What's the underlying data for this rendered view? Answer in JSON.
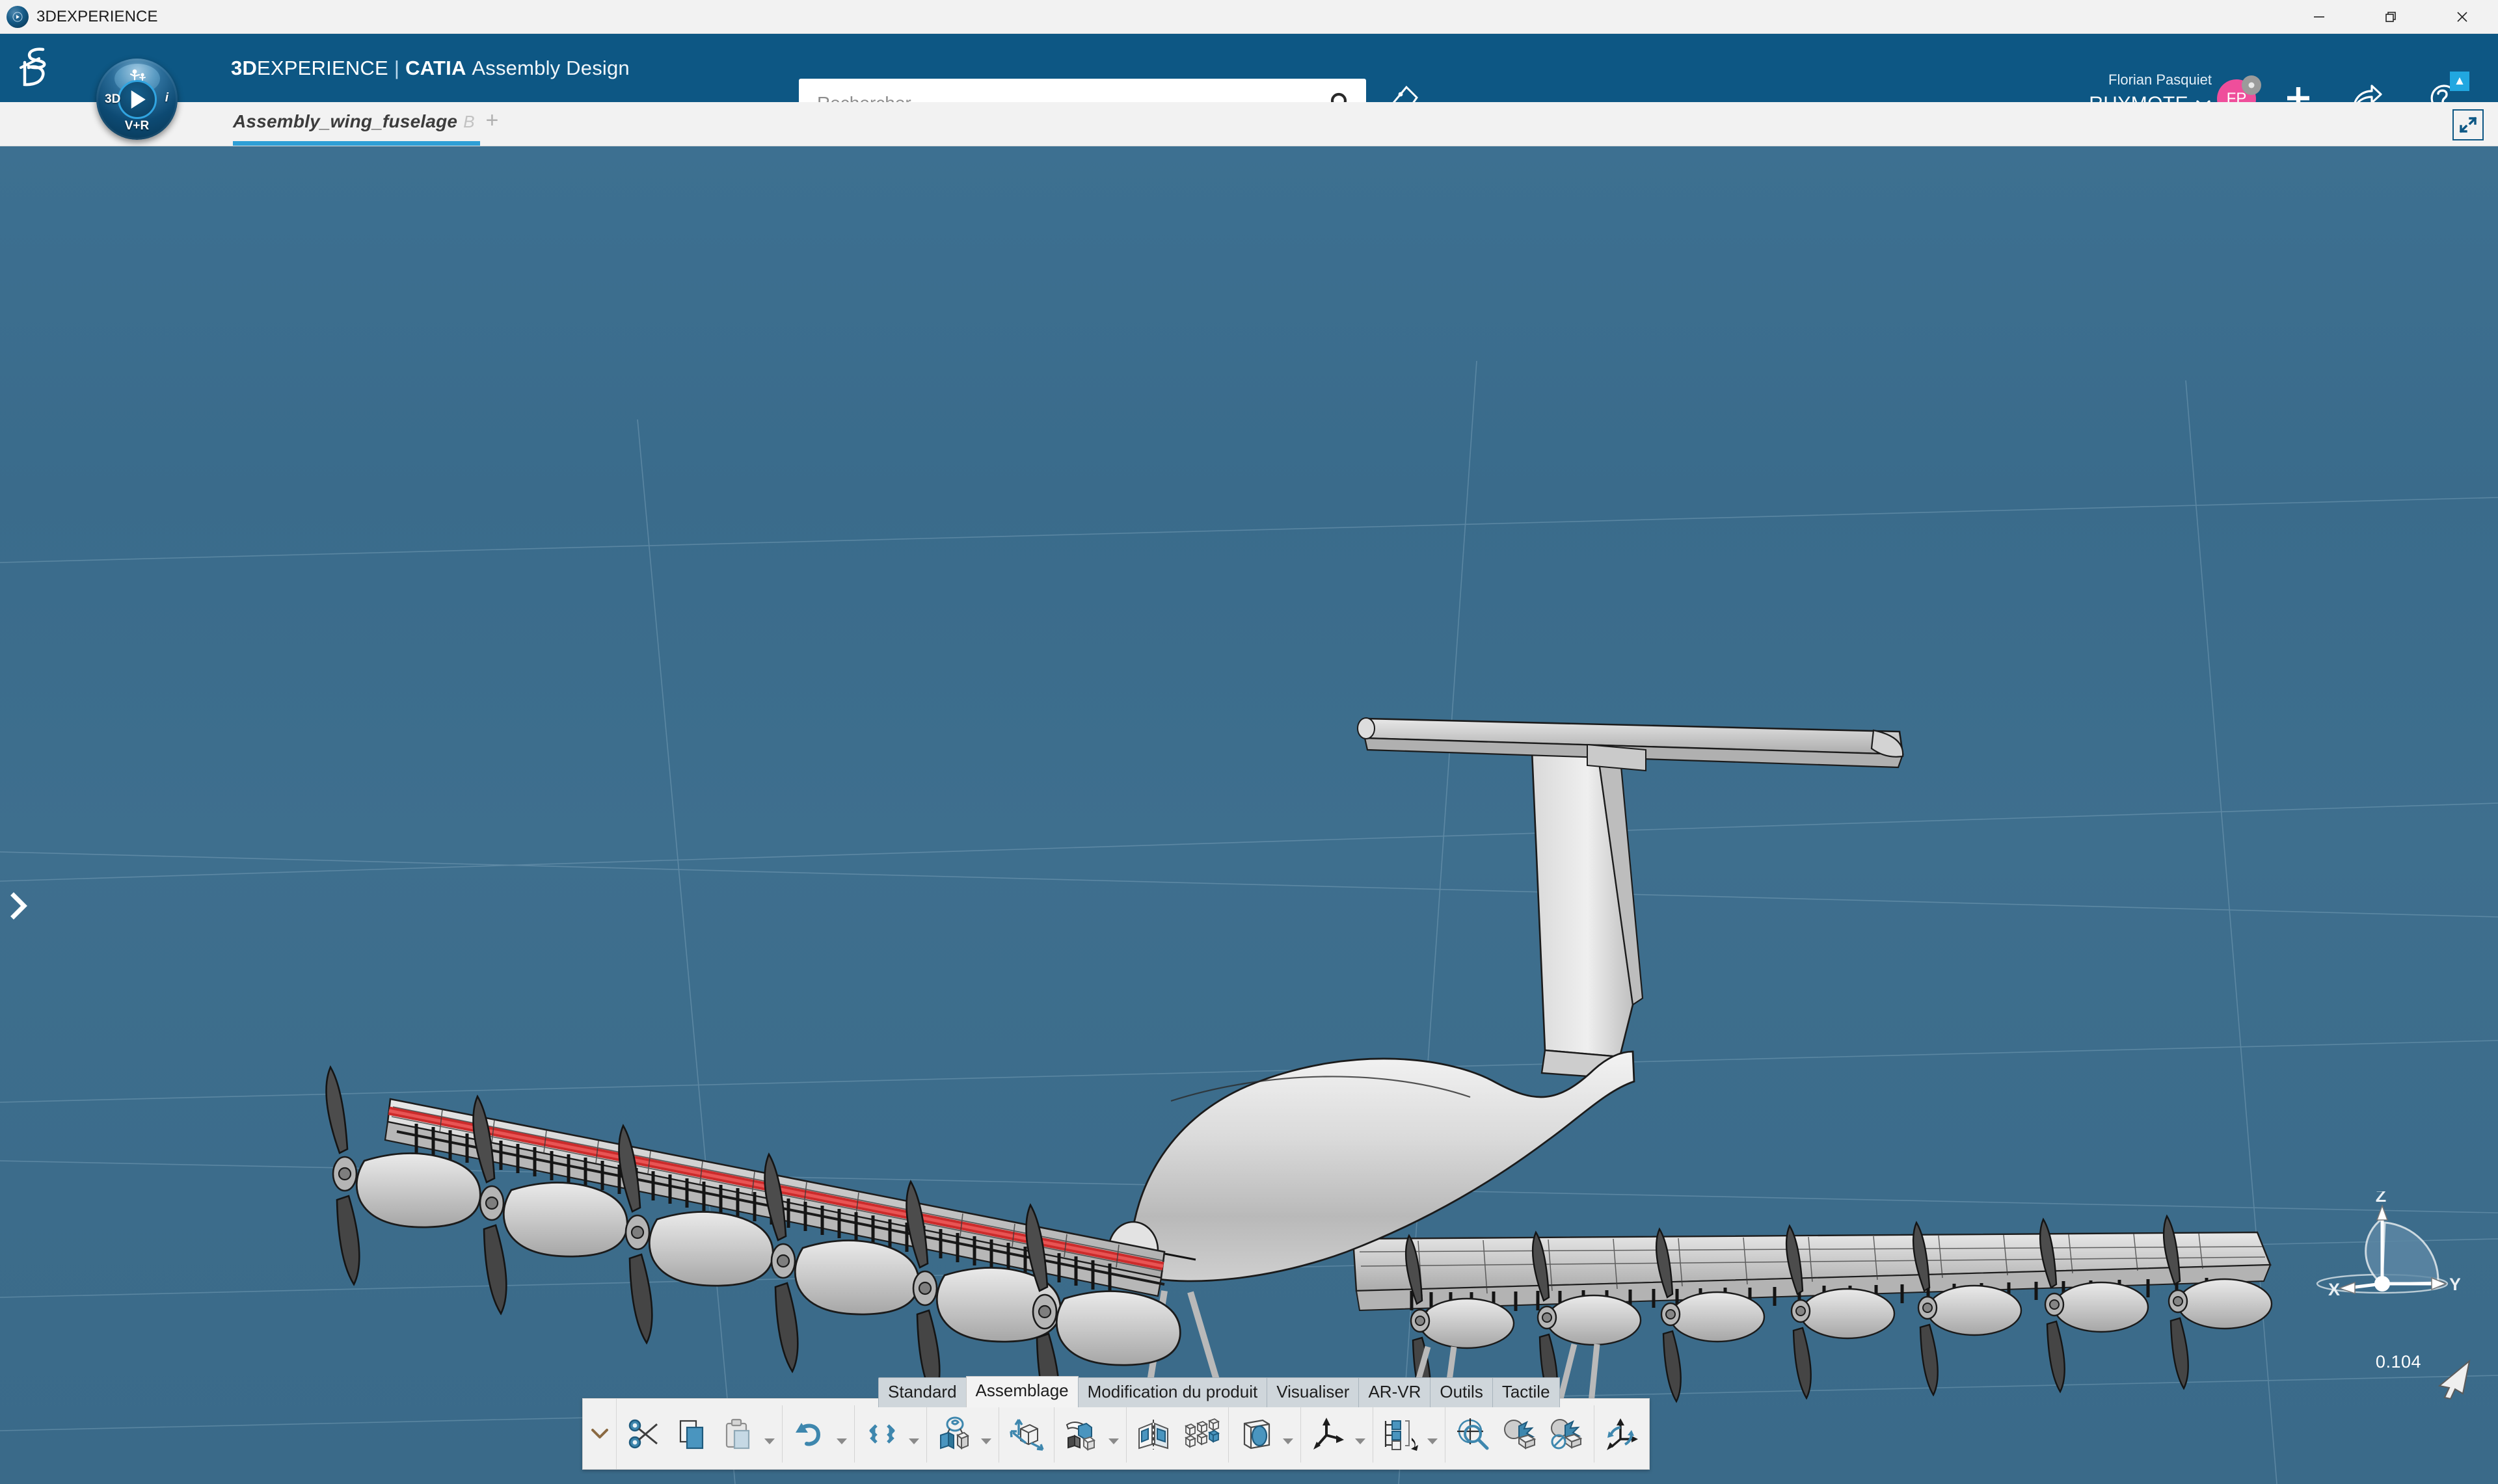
{
  "window": {
    "title": "3DEXPERIENCE",
    "logo_icon": "3dexperience-compass-icon",
    "controls": [
      {
        "name": "minimize",
        "icon": "minimize-icon"
      },
      {
        "name": "restore",
        "icon": "restore-icon"
      },
      {
        "name": "close",
        "icon": "close-icon"
      }
    ]
  },
  "header": {
    "brand_ds": "3DS",
    "compass": {
      "label_3d": "3D",
      "label_i": "i",
      "label_vr": "V+R",
      "man_glyph": "\u0001"
    },
    "app_title_3d": "3D",
    "app_title_experience": "EXPERIENCE",
    "app_title_separator": "|",
    "app_title_catia": "CATIA",
    "app_title_module": "Assembly Design",
    "search": {
      "value": "",
      "placeholder": "Rechercher",
      "search_icon": "search-icon"
    },
    "tag_icon": "tag-icon",
    "user": {
      "name": "Florian Pasquiet",
      "role": "RHYMOTE",
      "role_caret": "ˇ",
      "initials": "FP",
      "avatar_color": "#ef4e9b",
      "status_color": "#9b9b9b"
    },
    "actions": [
      {
        "name": "add-button",
        "icon": "plus-icon"
      },
      {
        "name": "share-button",
        "icon": "share-arrow-icon"
      },
      {
        "name": "help-button",
        "icon": "question-mark-icon"
      }
    ],
    "help_badge": "▲",
    "accent_color": "#0d5784"
  },
  "tabs": {
    "document_name": "Assembly_wing_fuselage",
    "document_suffix": "B",
    "add_tab": "+",
    "underline_color": "#2e9fd6",
    "fit_icon": "collapse-arrows-icon"
  },
  "viewport": {
    "expand_panel_icon": "chevron-right-icon",
    "background_top": "#3d7091",
    "background_bottom": "#3a6a89",
    "model": {
      "name": "Assembly_wing_fuselage",
      "description": "Distributed electric propulsion aircraft assembly",
      "highlight_color": "#cc2b2b"
    },
    "axis": {
      "x_label": "X",
      "y_label": "Y",
      "z_label": "Z",
      "scale_value": "0.104"
    },
    "cursor_icon": "mouse-pointer-icon"
  },
  "actionbar": {
    "tabs": [
      {
        "label": "Standard",
        "active": false
      },
      {
        "label": "Assemblage",
        "active": true
      },
      {
        "label": "Modification du produit",
        "active": false
      },
      {
        "label": "Visualiser",
        "active": false
      },
      {
        "label": "AR-VR",
        "active": false
      },
      {
        "label": "Outils",
        "active": false
      },
      {
        "label": "Tactile",
        "active": false
      }
    ],
    "collapse_icon": "chevron-down-icon",
    "tools": [
      {
        "name": "cut-tool",
        "icon": "scissors-icon",
        "caret": false
      },
      {
        "name": "copy-tool",
        "icon": "copy-pages-icon",
        "caret": false
      },
      {
        "name": "paste-tool",
        "icon": "clipboard-icon",
        "caret": true
      },
      {
        "name": "undo-tool",
        "icon": "undo-arrow-icon",
        "caret": true
      },
      {
        "name": "update-tool",
        "icon": "cycle-arrows-icon",
        "caret": true
      },
      {
        "name": "assembly-constraint-tool",
        "icon": "link-cubes-icon",
        "caret": true
      },
      {
        "name": "manipulate-tool",
        "icon": "move-cube-arrows-icon",
        "caret": false
      },
      {
        "name": "snap-tool",
        "icon": "hand-cube-icon",
        "caret": true
      },
      {
        "name": "mirror-tool",
        "icon": "mirror-cubes-icon",
        "caret": false
      },
      {
        "name": "pattern-tool",
        "icon": "pattern-cubes-icon",
        "caret": false
      },
      {
        "name": "section-tool",
        "icon": "section-box-icon",
        "caret": true
      },
      {
        "name": "axis-system-tool",
        "icon": "axis-arrows-icon",
        "caret": true
      },
      {
        "name": "structure-tool",
        "icon": "tree-nodes-icon",
        "caret": true
      },
      {
        "name": "search-assembly-tool",
        "icon": "magnifier-target-icon",
        "caret": false
      },
      {
        "name": "clash-tool",
        "icon": "clash-burst-icon",
        "caret": false
      },
      {
        "name": "clash-disable-tool",
        "icon": "clash-burst-disabled-icon",
        "caret": false
      },
      {
        "name": "rotate-tool",
        "icon": "rotate-axes-icon",
        "caret": false
      }
    ]
  }
}
